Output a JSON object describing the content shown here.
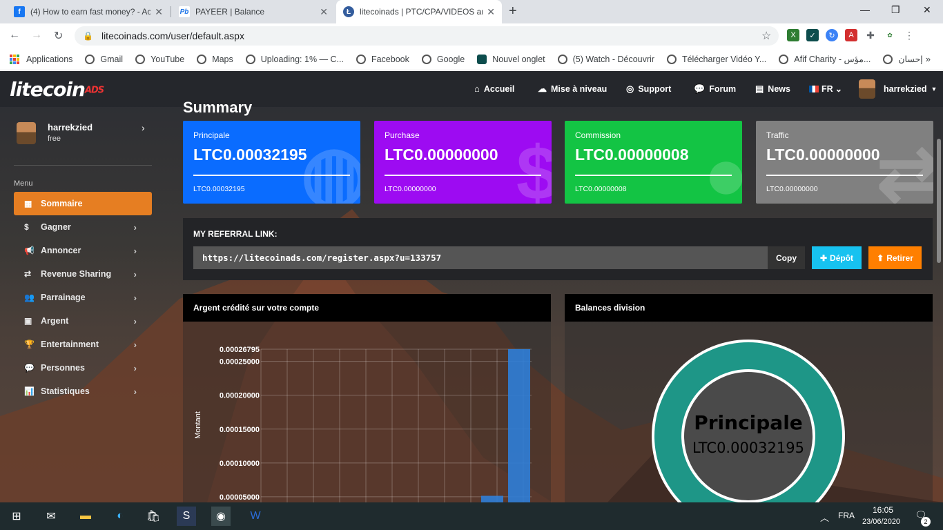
{
  "browser": {
    "tabs": [
      {
        "title": "(4) How to earn fast money? - Ac",
        "icon": "facebook-icon",
        "active": false
      },
      {
        "title": "PAYEER | Balance",
        "icon": "payeer-icon",
        "active": false
      },
      {
        "title": "litecoinads | PTC/CPA/VIDEOS an",
        "icon": "litecoin-icon",
        "active": true
      }
    ],
    "url": "litecoinads.com/user/default.aspx",
    "bookmarks": [
      "Applications",
      "Gmail",
      "YouTube",
      "Maps",
      "Uploading: 1% — C...",
      "Facebook",
      "Google",
      "Nouvel onglet",
      "(5) Watch - Découvrir",
      "Télécharger Vidéo Y...",
      "Afif Charity - مؤس...",
      "إحسان"
    ],
    "bookmarks_more": "»"
  },
  "site": {
    "logo": "litecoin",
    "logo_suffix": "ADS",
    "nav": [
      "Accueil",
      "Mise à niveau",
      "Support",
      "Forum",
      "News"
    ],
    "lang": "FR",
    "user": "harrekzied"
  },
  "sidebar": {
    "name": "harrekzied",
    "role": "free",
    "menu_title": "Menu",
    "items": [
      "Sommaire",
      "Gagner",
      "Annoncer",
      "Revenue Sharing",
      "Parrainage",
      "Argent",
      "Entertainment",
      "Personnes",
      "Statistiques"
    ]
  },
  "main": {
    "title": "Summary",
    "cards": [
      {
        "label": "Principale",
        "value": "LTC0.00032195",
        "sub": "LTC0.00032195",
        "color": "#0a6cff"
      },
      {
        "label": "Purchase",
        "value": "LTC0.00000000",
        "sub": "LTC0.00000000",
        "color": "#9d0bf2"
      },
      {
        "label": "Commission",
        "value": "LTC0.00000008",
        "sub": "LTC0.00000008",
        "color": "#13c444"
      },
      {
        "label": "Traffic",
        "value": "LTC0.00000000",
        "sub": "LTC0.00000000",
        "color": "#808080"
      }
    ],
    "referral_title": "MY REFERRAL LINK:",
    "referral_link": "https://litecoinads.com/register.aspx?u=133757",
    "copy_label": "Copy",
    "deposit_label": "Dépôt",
    "withdraw_label": "Retirer",
    "panel_left_title": "Argent crédité sur votre compte",
    "panel_right_title": "Balances division",
    "donut_label": "Principale",
    "donut_value": "LTC0.00032195"
  },
  "chart_data": {
    "type": "bar",
    "ylabel": "Montant",
    "ytick_labels": [
      "0.00026795",
      "0.00025000",
      "0.00020000",
      "0.00015000",
      "0.00010000",
      "0.00005000"
    ],
    "ylim": [
      0,
      0.00026795
    ],
    "values": [
      5.15e-05,
      0.00026795
    ],
    "color": "#2f7ed8"
  },
  "taskbar": {
    "lang": "FRA",
    "time": "16:05",
    "date": "23/06/2020",
    "notif": "2"
  }
}
